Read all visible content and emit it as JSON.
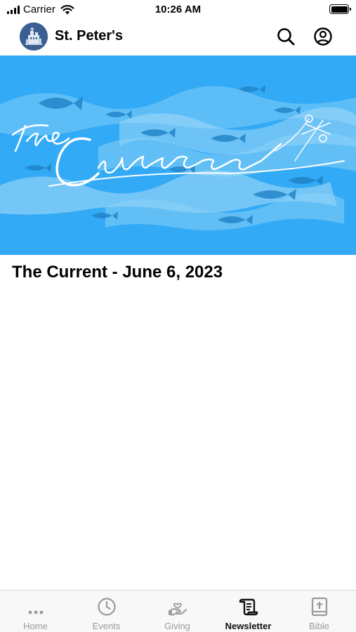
{
  "status_bar": {
    "carrier": "Carrier",
    "time": "10:26 AM"
  },
  "header": {
    "title": "St. Peter's",
    "logo_icon": "church-logo-icon",
    "search_icon": "search-icon",
    "account_icon": "account-icon"
  },
  "banner": {
    "image": "the-current-banner"
  },
  "article": {
    "title": "The Current - June 6, 2023"
  },
  "tabs": [
    {
      "label": "Home",
      "icon": "more-dots-icon"
    },
    {
      "label": "Events",
      "icon": "clock-icon"
    },
    {
      "label": "Giving",
      "icon": "giving-hand-icon"
    },
    {
      "label": "Newsletter",
      "icon": "newsletter-icon",
      "active": true
    },
    {
      "label": "Bible",
      "icon": "bible-icon"
    }
  ],
  "colors": {
    "banner_bg": "#33aaf5",
    "logo_bg": "#3b5f93",
    "active_tab": "#111111",
    "inactive_tab": "#9a9a9a"
  }
}
